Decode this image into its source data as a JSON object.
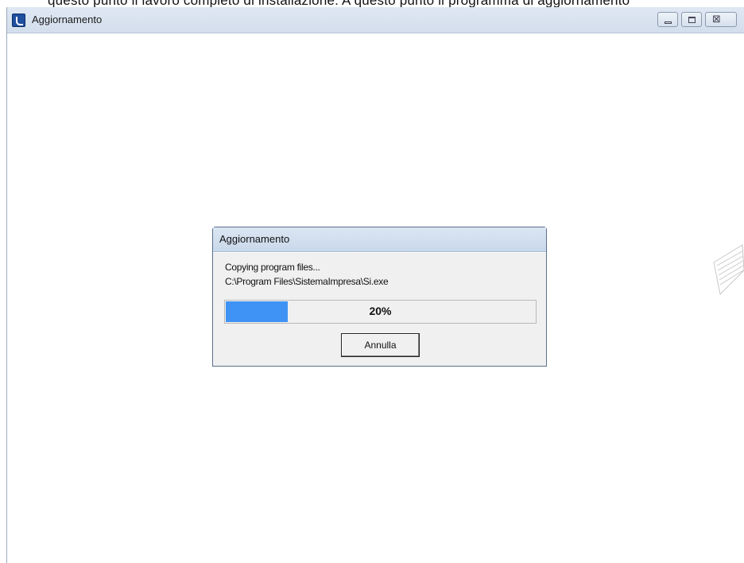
{
  "top_fragment": "questo punto il lavoro completo di installazione. A questo punto il programma di aggiornamento",
  "main_window": {
    "title": "Aggiornamento",
    "icon": "app-icon",
    "controls": {
      "minimize": "minimize-icon",
      "maximize": "maximize-icon",
      "close_glyph": "⊠"
    }
  },
  "dialog": {
    "title": "Aggiornamento",
    "status": "Copying program files...",
    "path": "C:\\Program Files\\SistemaImpresa\\Si.exe",
    "progress_value": 0.2,
    "progress_label": "20%",
    "cancel_label": "Annulla"
  },
  "colors": {
    "progress_fill": "#3f93f5",
    "titlebar": "#d3deec"
  }
}
